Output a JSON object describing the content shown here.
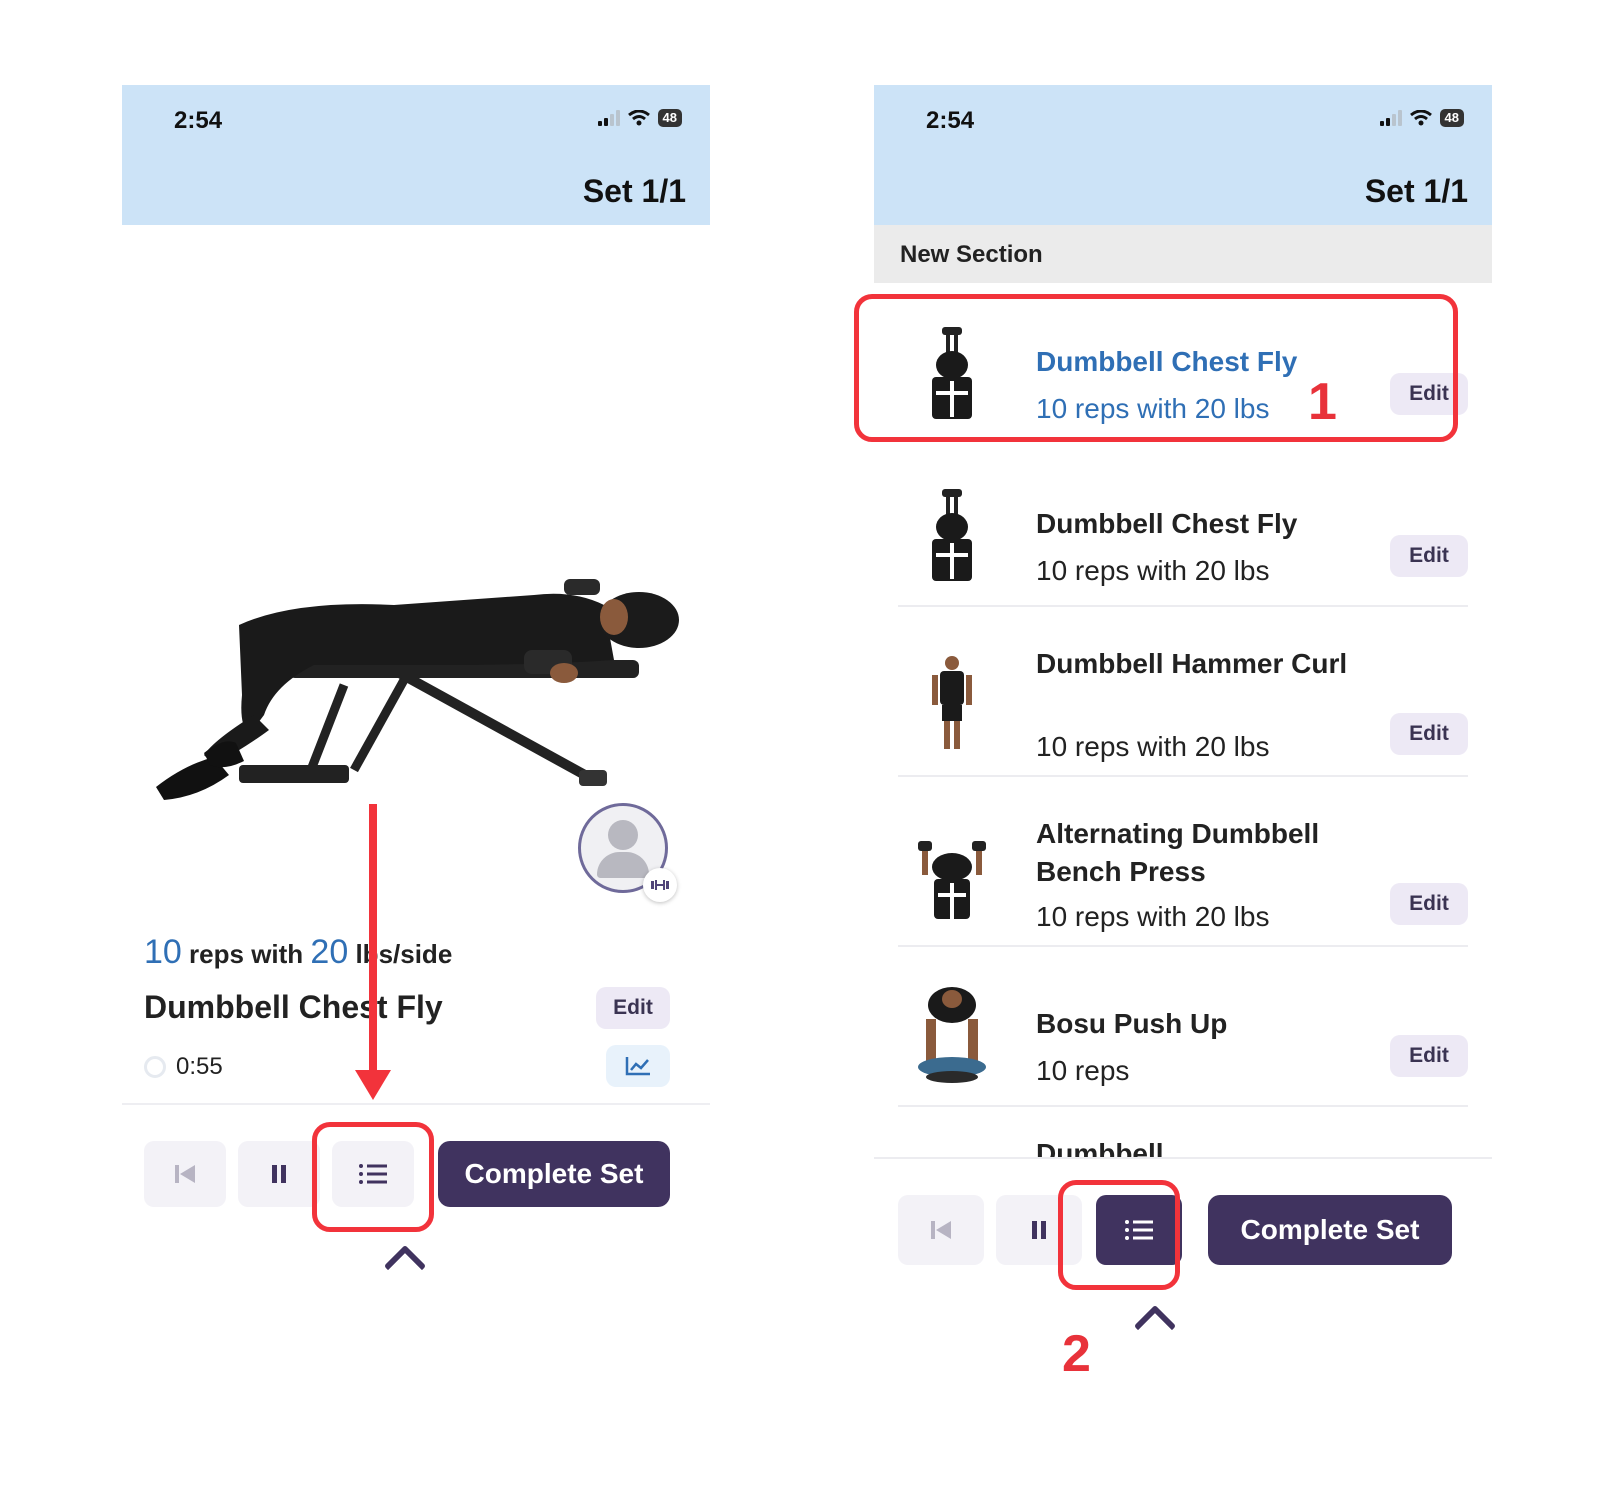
{
  "left_screen": {
    "status": {
      "time": "2:54",
      "battery": "48"
    },
    "header": {
      "set_label": "Set 1/1"
    },
    "exercise": {
      "reps_value": "10",
      "reps_text": " reps with ",
      "weight_value": "20",
      "weight_unit": " lbs/side",
      "name": "Dumbbell Chest Fly",
      "edit_label": "Edit",
      "timer": "0:55"
    },
    "controls": {
      "complete_label": "Complete Set"
    }
  },
  "right_screen": {
    "status": {
      "time": "2:54",
      "battery": "48"
    },
    "header": {
      "set_label": "Set 1/1"
    },
    "section_label": "New Section",
    "items": [
      {
        "title": "Dumbbell Chest Fly",
        "subtitle": "10 reps with 20 lbs",
        "edit": "Edit",
        "selected": true
      },
      {
        "title": "Dumbbell Chest Fly",
        "subtitle": "10 reps with 20 lbs",
        "edit": "Edit"
      },
      {
        "title": "Dumbbell Hammer Curl",
        "subtitle": "10 reps with 20 lbs",
        "edit": "Edit"
      },
      {
        "title": "Alternating Dumbbell Bench Press",
        "subtitle": "10 reps with 20 lbs",
        "edit": "Edit"
      },
      {
        "title": "Bosu Push Up",
        "subtitle": "10 reps",
        "edit": "Edit"
      },
      {
        "title": "Dumbbell"
      }
    ],
    "controls": {
      "complete_label": "Complete Set"
    }
  },
  "annotations": {
    "one": "1",
    "two": "2"
  },
  "colors": {
    "accent": "#40335f",
    "link_blue": "#2f6fb5",
    "header_bg": "#cce3f7",
    "annotation_red": "#f2333b"
  }
}
